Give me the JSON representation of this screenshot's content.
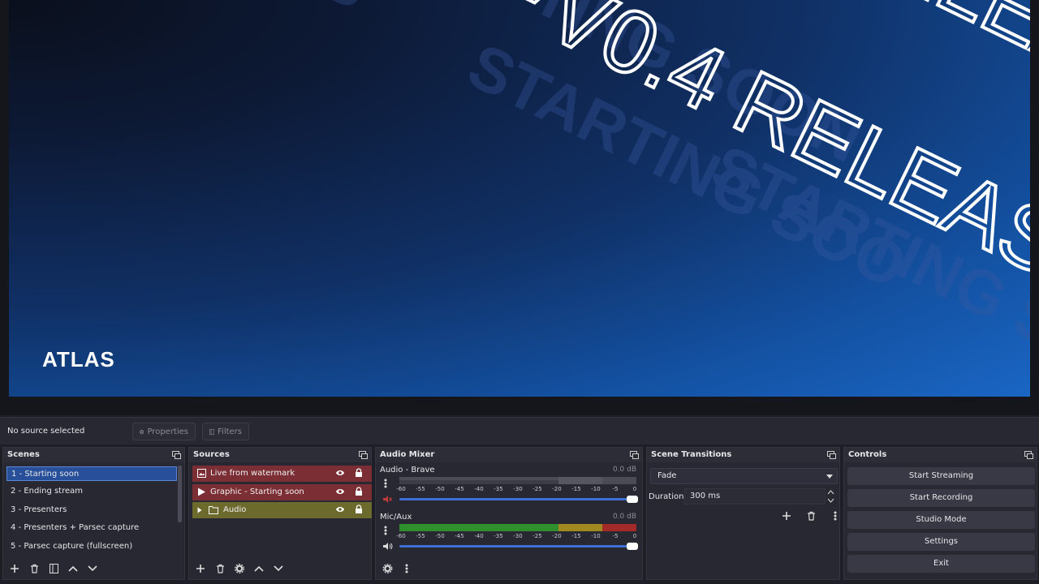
{
  "preview": {
    "logo": "ATLAS",
    "headline_big": "V0.4 RELEAS",
    "headline_top": "V",
    "headline_top_right": "ELEA",
    "bg_text_1": "STARTING SOO",
    "bg_text_2": "TING SOON",
    "bg_text_3": "STARTING SO",
    "bg_text_4": "S"
  },
  "status": {
    "no_source": "No source selected",
    "properties_label": "Properties",
    "filters_label": "Filters"
  },
  "scenes": {
    "title": "Scenes",
    "items": [
      {
        "label": "1 - Starting soon",
        "selected": true
      },
      {
        "label": "2 - Ending stream"
      },
      {
        "label": "3 - Presenters"
      },
      {
        "label": "4 - Presenters + Parsec capture"
      },
      {
        "label": "5 - Parsec capture (fullscreen)"
      }
    ]
  },
  "sources": {
    "title": "Sources",
    "items": [
      {
        "label": "Live from watermark",
        "type": "image-icon",
        "color": "#7b2e34"
      },
      {
        "label": "Graphic - Starting soon",
        "type": "play-icon",
        "color": "#7b2e34"
      },
      {
        "label": "Audio",
        "type": "folder-icon",
        "color": "#6d6a2d"
      }
    ]
  },
  "mixer": {
    "title": "Audio Mixer",
    "channels": [
      {
        "name": "Audio - Brave",
        "db": "0.0 dB",
        "muted": true,
        "level": 0.0,
        "fader": 1.0
      },
      {
        "name": "Mic/Aux",
        "db": "0.0 dB",
        "muted": false,
        "level": 1.0,
        "fader": 1.0
      }
    ],
    "ticks": [
      "-60",
      "-55",
      "-50",
      "-45",
      "-40",
      "-35",
      "-30",
      "-25",
      "-20",
      "-15",
      "-10",
      "-5",
      "0"
    ]
  },
  "transitions": {
    "title": "Scene Transitions",
    "selected": "Fade",
    "duration_label": "Duration",
    "duration_value": "300 ms"
  },
  "controls": {
    "title": "Controls",
    "buttons": [
      "Start Streaming",
      "Start Recording",
      "Studio Mode",
      "Settings",
      "Exit"
    ]
  },
  "colors": {
    "accent": "#284f9a",
    "meter_green": "#2f8f2f",
    "meter_yellow": "#a08a20",
    "meter_red": "#a42a2a",
    "fader_blue": "#3f6fd6"
  }
}
